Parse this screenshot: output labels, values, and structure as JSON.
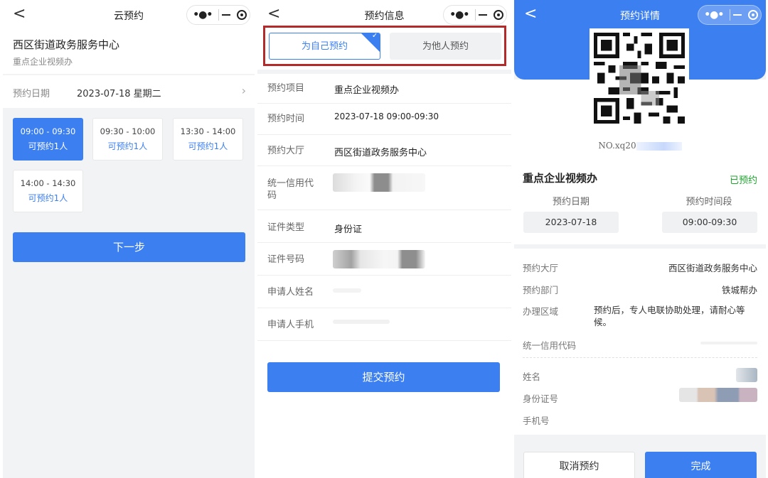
{
  "panel1": {
    "nav": {
      "back": "<",
      "title": "云预约"
    },
    "center_name": "西区街道政务服务中心",
    "center_sub": "重点企业视频办",
    "date_label": "预约日期",
    "date_value": "2023-07-18 星期二",
    "date_arrow": "›",
    "slots": [
      {
        "time": "09:00 - 09:30",
        "avail": "可预约1人",
        "selected": true
      },
      {
        "time": "09:30 - 10:00",
        "avail": "可预约1人",
        "selected": false
      },
      {
        "time": "13:30 - 14:00",
        "avail": "可预约1人",
        "selected": false
      },
      {
        "time": "14:00 - 14:30",
        "avail": "可预约1人",
        "selected": false
      }
    ],
    "next_button": "下一步"
  },
  "panel2": {
    "nav": {
      "back": "<",
      "title": "预约信息"
    },
    "tab_self": "为自己预约",
    "tab_other": "为他人预约",
    "fields": [
      {
        "label": "预约项目",
        "value": "重点企业视频办"
      },
      {
        "label": "预约时间",
        "value": "2023-07-18 09:00-09:30"
      },
      {
        "label": "预约大厅",
        "value": "西区街道政务服务中心"
      },
      {
        "label": "统一信用代码",
        "value": ""
      },
      {
        "label": "证件类型",
        "value": "身份证"
      },
      {
        "label": "证件号码",
        "value": ""
      },
      {
        "label": "申请人姓名",
        "value": ""
      },
      {
        "label": "申请人手机",
        "value": ""
      }
    ],
    "submit_button": "提交预约"
  },
  "panel3": {
    "nav": {
      "back": "<",
      "title": "预约详情"
    },
    "qr_number": "NO.xq20",
    "project": "重点企业视频办",
    "status": "已预约",
    "date_header": "预约日期",
    "time_header": "预约时间段",
    "date_value": "2023-07-18",
    "time_value": "09:00-09:30",
    "details": [
      {
        "label": "预约大厅",
        "value": "西区街道政务服务中心"
      },
      {
        "label": "预约部门",
        "value": "铁城帮办"
      },
      {
        "label": "办理区域",
        "value": "预约后，专人电联协助处理，请耐心等候。"
      },
      {
        "label": "统一信用代码",
        "value": ""
      },
      {
        "label": "姓名",
        "value": ""
      },
      {
        "label": "身份证号",
        "value": ""
      },
      {
        "label": "手机号",
        "value": ""
      }
    ],
    "cancel_button": "取消预约",
    "done_button": "完成"
  },
  "colors": {
    "accent": "#3b7ff0",
    "status_green": "#1aa52b",
    "highlight_box": "#b22a2a"
  }
}
